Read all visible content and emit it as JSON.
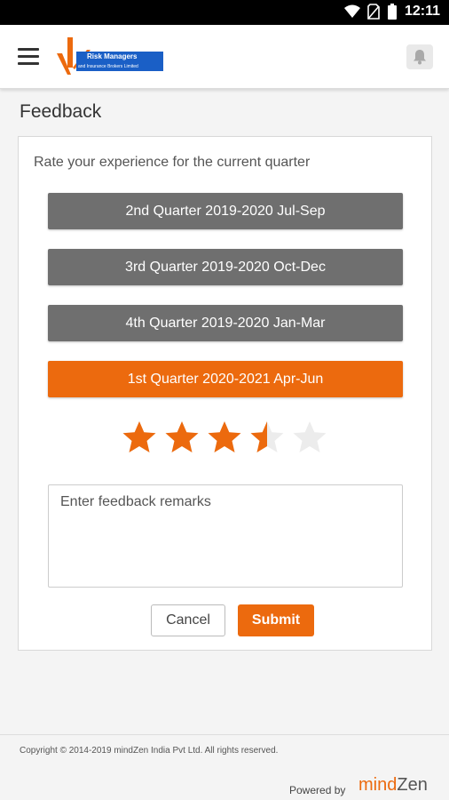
{
  "status_bar": {
    "time": "12:11"
  },
  "header": {
    "logo": {
      "line1": "Risk Managers",
      "line2": "and Insurance Brokers Limited"
    }
  },
  "page": {
    "title": "Feedback"
  },
  "feedback": {
    "prompt": "Rate your experience for the current quarter",
    "quarters": [
      {
        "label": "2nd Quarter 2019-2020 Jul-Sep",
        "selected": false
      },
      {
        "label": "3rd Quarter 2019-2020 Oct-Dec",
        "selected": false
      },
      {
        "label": "4th Quarter 2019-2020 Jan-Mar",
        "selected": false
      },
      {
        "label": "1st Quarter 2020-2021 Apr-Jun",
        "selected": true
      }
    ],
    "rating": {
      "value": 3.5,
      "max": 5
    },
    "remarks_placeholder": "Enter feedback remarks",
    "cancel_label": "Cancel",
    "submit_label": "Submit"
  },
  "footer": {
    "copyright": "Copyright © 2014-2019 mindZen India Pvt Ltd. All rights reserved.",
    "powered_by": "Powered by",
    "brand_part1": "mind",
    "brand_part2": "Zen"
  },
  "colors": {
    "accent": "#ec6a0e",
    "quarter_button": "#6f6f6f",
    "logo_blue": "#1a5fc6"
  }
}
